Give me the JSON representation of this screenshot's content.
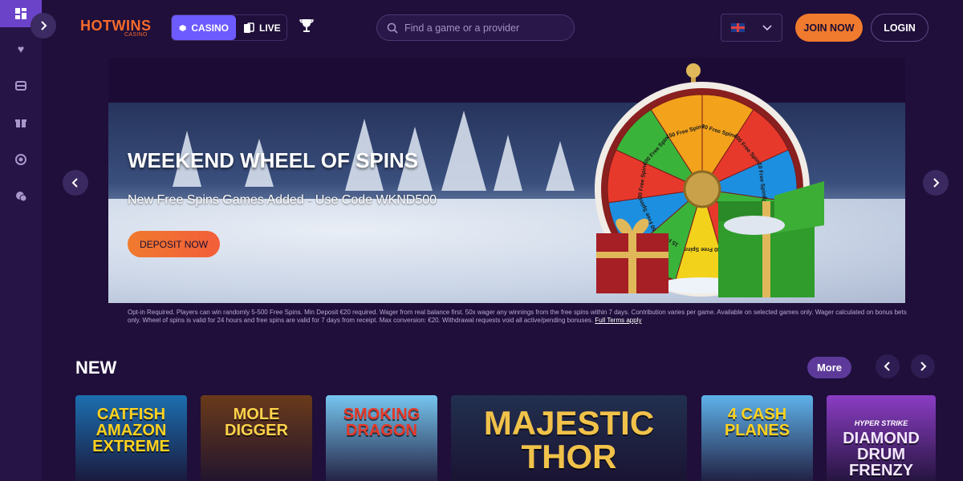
{
  "header": {
    "logo_text": "HOTWINS",
    "logo_sub": "CASINO",
    "tabs": [
      {
        "label": "CASINO",
        "icon": "cube-icon"
      },
      {
        "label": "LIVE",
        "icon": "cards-icon"
      }
    ],
    "search_placeholder": "Find a game or a provider",
    "join_label": "JOIN NOW",
    "login_label": "LOGIN"
  },
  "sidebar": {
    "items": [
      "dashboard-icon",
      "heart-icon",
      "casino-chip-icon",
      "gift-icon",
      "target-icon",
      "chat-icon"
    ]
  },
  "banner": {
    "title": "WEEKEND WHEEL OF SPINS",
    "subtitle": "New Free Spins Games Added - Use Code WKND500",
    "cta": "DEPOSIT NOW",
    "wheel_segments": [
      "20 Free Spins",
      "300 Free Spins",
      "10 Free Spins",
      "500 Free Spins",
      "5 Free Spins",
      "80 Free Spins",
      "15 Free",
      "50 Free Spins",
      "30 Free Spins",
      "100 Free Spins",
      "150 Free Spins"
    ],
    "terms": "Opt-in Required. Players can win randomly 5-500 Free Spins. Min Deposit €20 required. Wager from real balance first. 50x wager any winnings from the free spins within 7 days. Contribution varies per game. Available on selected games only. Wager calculated on bonus bets only. Wheel of spins is valid for 24 hours and free spins are valid for 7 days from receipt. Max conversion: €20. Withdrawal requests void all active/pending bonuses.",
    "terms_link": "Full Terms apply"
  },
  "new_section": {
    "title": "NEW",
    "more_label": "More",
    "games": [
      {
        "title": "CATFISH AMAZON EXTREME",
        "bg": "#1c6fb0",
        "fg": "#ffd21f"
      },
      {
        "title": "MOLE DIGGER",
        "bg": "#6a3a1a",
        "fg": "#ffd24a"
      },
      {
        "title": "SMOKING DRAGON",
        "bg": "#76c6f0",
        "fg": "#e63a2a"
      },
      {
        "title": "MAJESTIC THOR",
        "bg": "#22304f",
        "fg": "#f1c24a"
      },
      {
        "title": "4 CASH PLANES",
        "bg": "#5fb2ea",
        "fg": "#ffd21f"
      },
      {
        "title": "DIAMOND DRUM FRENZY",
        "bg": "#8b3dc4",
        "fg": "#f4e7ff",
        "badge": "HYPER STRIKE"
      }
    ]
  },
  "colors": {
    "bg": "#1f0f3a",
    "sidebar": "#261446",
    "accent": "#f07a2e",
    "casino_tab": "#6d5bff"
  }
}
